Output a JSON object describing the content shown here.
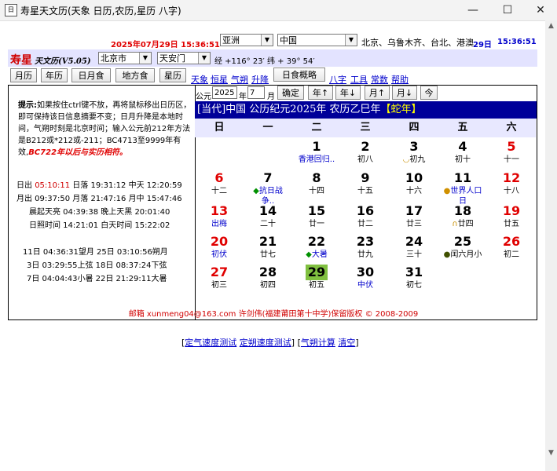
{
  "window": {
    "icon": "日",
    "title": "寿星天文历(天象 日历,农历,星历 八字)",
    "minimize": "—",
    "maximize": "☐",
    "close": "✕"
  },
  "top": {
    "datetime": "2025年07月29日 15:36:51",
    "continent": "亚洲",
    "country": "中国",
    "cities": "北京、乌鲁木齐、台北、港澳",
    "day": "29日",
    "time": "15:36:51"
  },
  "header": {
    "logo": "寿星",
    "logo_sub": "天文历(V5.05)",
    "city": "北京市",
    "district": "天安门",
    "coords": "经 +116° 23′ 纬 + 39° 54′"
  },
  "toolbar": {
    "buttons": [
      "月历",
      "年历",
      "日月食",
      "地方食",
      "星历"
    ],
    "links1": [
      "天象",
      "恒星",
      "气朔",
      "升降"
    ],
    "eclipse_button": "日食概略",
    "links2": [
      "八字",
      "工具",
      "常数",
      "帮助"
    ]
  },
  "controls": {
    "era_label": "公元",
    "year": "2025",
    "year_label": "年",
    "month": "7",
    "month_label": "月",
    "confirm": "确定",
    "prev_year": "年↑",
    "next_year": "年↓",
    "prev_month": "月↑",
    "next_month": "月↓",
    "today": "今"
  },
  "calendar": {
    "title_main": "[当代]中国 公历纪元2025年 农历乙巳年",
    "title_zodiac": "【蛇年】",
    "weekdays": [
      "日",
      "一",
      "二",
      "三",
      "四",
      "五",
      "六"
    ],
    "cells": [
      {
        "n": "1",
        "l": "香港回归.."
      },
      {
        "n": "2",
        "l": "初八"
      },
      {
        "n": "3",
        "l": "初九",
        "m": "◡"
      },
      {
        "n": "4",
        "l": "初十"
      },
      {
        "n": "5",
        "l": "十一"
      },
      {
        "n": "6",
        "l": "十二"
      },
      {
        "n": "7",
        "l": "抗日战争..",
        "m": "◆"
      },
      {
        "n": "8",
        "l": "十四"
      },
      {
        "n": "9",
        "l": "十五"
      },
      {
        "n": "10",
        "l": "十六"
      },
      {
        "n": "11",
        "l": "世界人口日",
        "m": "●"
      },
      {
        "n": "12",
        "l": "十八"
      },
      {
        "n": "13",
        "l": "出梅"
      },
      {
        "n": "14",
        "l": "二十"
      },
      {
        "n": "15",
        "l": "廿一"
      },
      {
        "n": "16",
        "l": "廿二"
      },
      {
        "n": "17",
        "l": "廿三"
      },
      {
        "n": "18",
        "l": "廿四",
        "m": "∩"
      },
      {
        "n": "19",
        "l": "廿五"
      },
      {
        "n": "20",
        "l": "初伏"
      },
      {
        "n": "21",
        "l": "廿七"
      },
      {
        "n": "22",
        "l": "大暑",
        "m": "◆"
      },
      {
        "n": "23",
        "l": "廿九"
      },
      {
        "n": "24",
        "l": "三十"
      },
      {
        "n": "25",
        "l": "闰六月小",
        "m": "●"
      },
      {
        "n": "26",
        "l": "初二"
      },
      {
        "n": "27",
        "l": "初三"
      },
      {
        "n": "28",
        "l": "初四"
      },
      {
        "n": "29",
        "l": "初五"
      },
      {
        "n": "30",
        "l": "中伏"
      },
      {
        "n": "31",
        "l": "初七"
      }
    ]
  },
  "tip": {
    "label": "提示:",
    "text": "如果按住ctrl键不放，再将鼠标移出日历区，即可保持该日信息摘要不变；日月升降是本地时间，气朔时刻是北京时间；输入公元前212年方法是B212或*212或-211；BC4713至9999年有效,",
    "warning": "BC722年以后与实历相符。"
  },
  "sun_moon": {
    "sun_row": {
      "label1": "日出",
      "v1": "05:10:11",
      "label2": "日落",
      "v2": "19:31:12",
      "label3": "中天",
      "v3": "12:20:59"
    },
    "moon_row": "月出 09:37:50 月落 21:47:16 月中 15:47:46",
    "twilight_row": "晨起天亮 04:39:38 晚上天黑 20:01:40",
    "duration_row": "日照时间 14:21:01 白天时间 15:22:02"
  },
  "phases": [
    "11日 04:36:31望月   25日 03:10:56朔月",
    "3日 03:29:55上弦   18日 08:37:24下弦",
    "7日 04:04:43小暑   22日 21:29:11大暑"
  ],
  "footer": {
    "text": "邮箱 xunmeng04@163.com 许剑伟(福建莆田第十中学)保留版权 © 2008-2009"
  },
  "bottom": {
    "bracket_open1": "[",
    "link1": "定气速度测试",
    "link2": "定朔速度测试",
    "bracket_close1": "]",
    "bracket_open2": "[",
    "link3": "气朔计算",
    "link4": "清空",
    "bracket_close2": "]"
  },
  "colors": {
    "header_bg": "#000099",
    "zodiac": "#ffff00",
    "sunday": "#e00000",
    "highlight": "#80c040",
    "festival": "#0000cc"
  }
}
